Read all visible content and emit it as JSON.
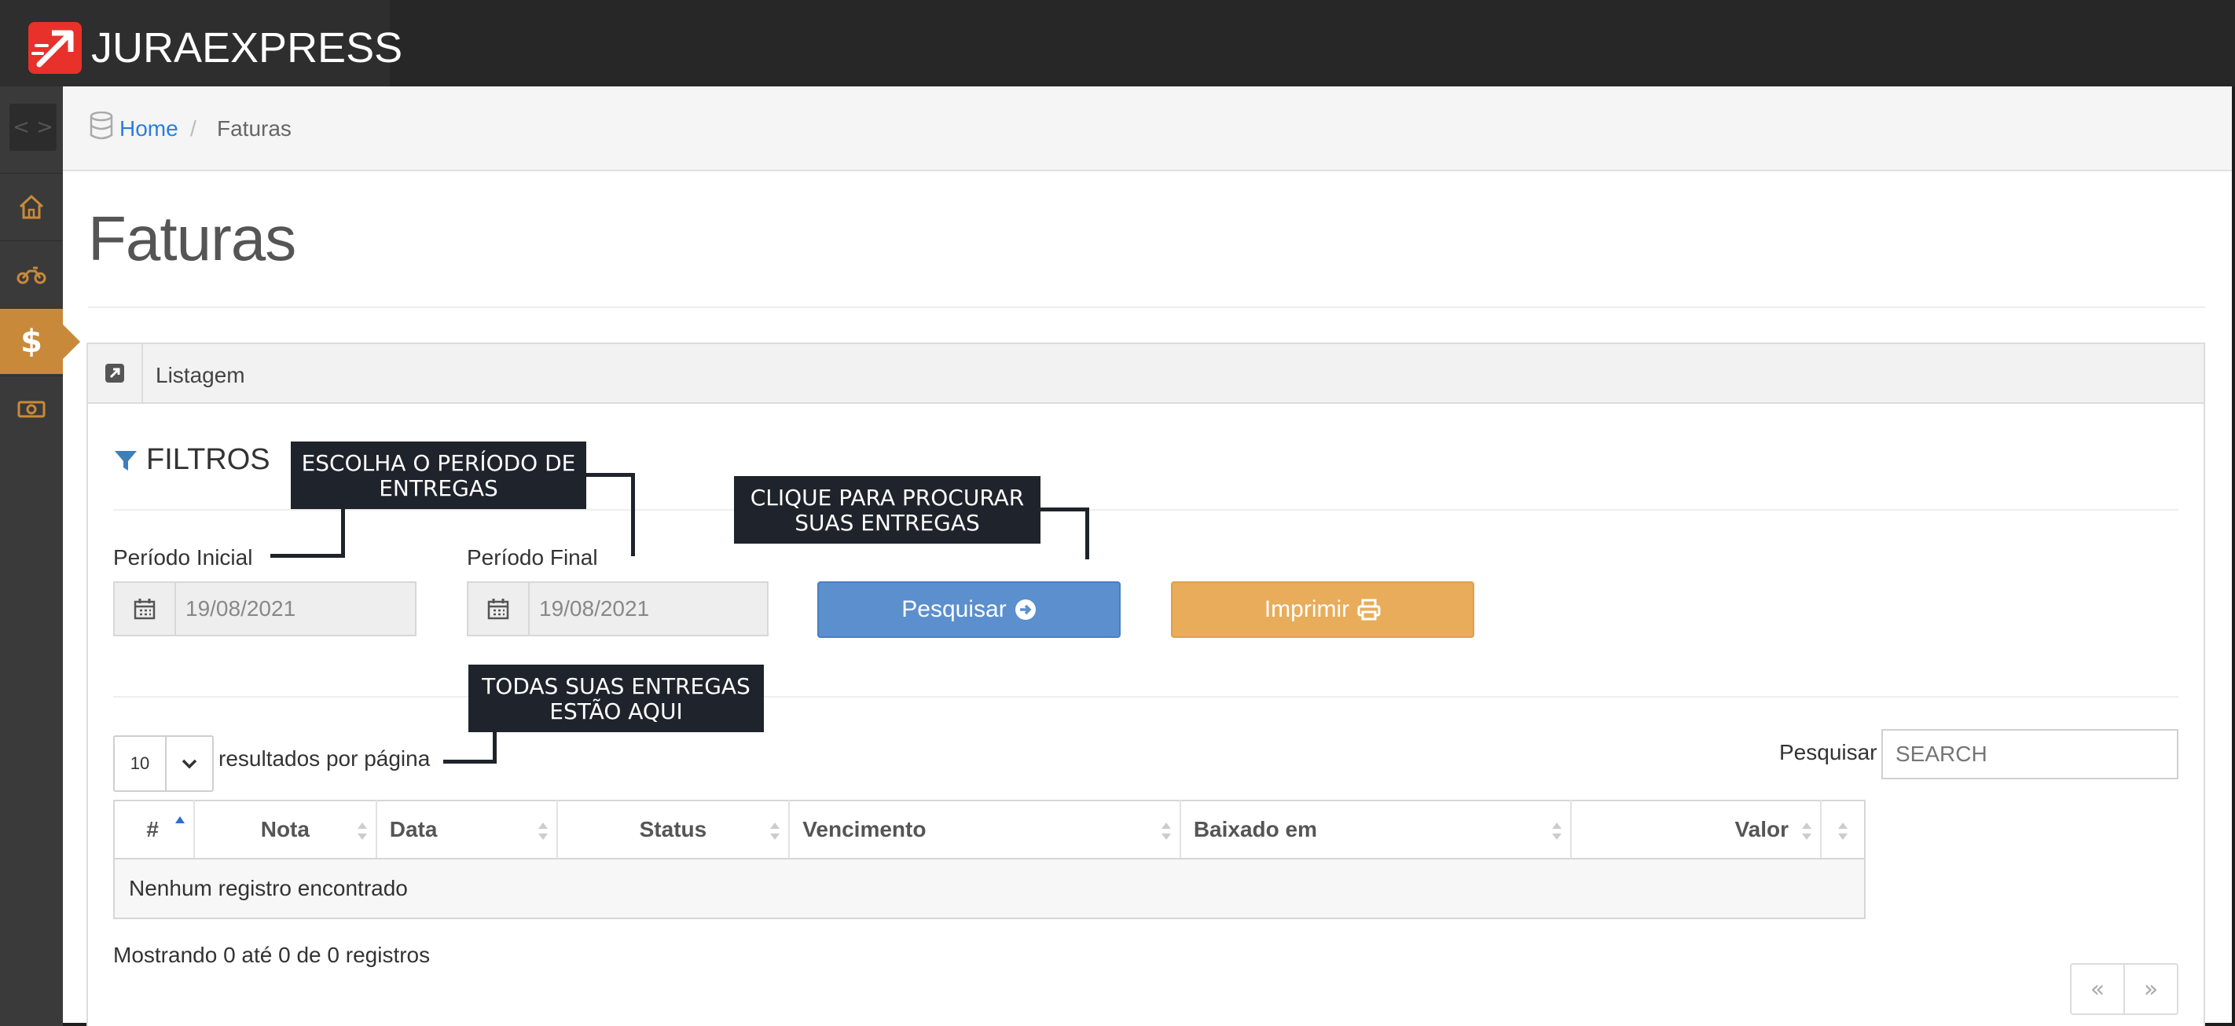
{
  "brand": {
    "name": "JURAEXPRESS",
    "accent": "#e8312a"
  },
  "sidebar": {
    "toggle_icon": "code-icon",
    "items": [
      {
        "icon": "home-icon",
        "active": false
      },
      {
        "icon": "motorcycle-icon",
        "active": false
      },
      {
        "icon": "dollar-icon",
        "glyph": "$",
        "active": true
      },
      {
        "icon": "money-icon",
        "active": false
      }
    ]
  },
  "breadcrumb": {
    "home": "Home",
    "separator": "/",
    "current": "Faturas"
  },
  "page": {
    "title": "Faturas"
  },
  "panel": {
    "title": "Listagem"
  },
  "filters": {
    "heading": "FILTROS",
    "start_label": "Período Inicial",
    "start_value": "19/08/2021",
    "end_label": "Período Final",
    "end_value": "19/08/2021",
    "search_button": "Pesquisar",
    "print_button": "Imprimir"
  },
  "table_controls": {
    "page_length": "10",
    "page_length_label": "resultados por página",
    "search_label": "Pesquisar",
    "search_placeholder": "SEARCH"
  },
  "table": {
    "columns": [
      "#",
      "Nota",
      "Data",
      "Status",
      "Vencimento",
      "Baixado em",
      "Valor",
      ""
    ],
    "empty_message": "Nenhum registro encontrado",
    "info": "Mostrando 0 até 0 de 0 registros"
  },
  "pagination": {
    "prev": "«",
    "next": "»"
  },
  "callouts": {
    "period": "ESCOLHA O PERÍODO DE ENTREGAS",
    "search": "CLIQUE PARA PROCURAR SUAS ENTREGAS",
    "list": "TODAS SUAS ENTREGAS ESTÃO AQUI"
  },
  "colors": {
    "topbar": "#272727",
    "sidebar": "#3a3a3a",
    "sidebar_active": "#c88a3a",
    "primary": "#5b8fcd",
    "warning": "#e8ac5a",
    "link": "#2b7de1",
    "callout": "#1f232b"
  }
}
